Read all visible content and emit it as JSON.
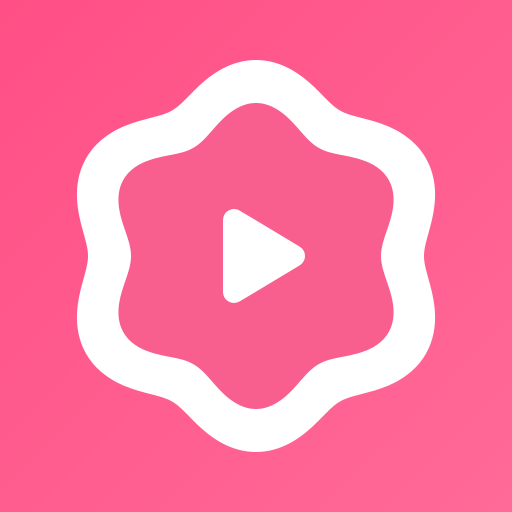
{
  "icon": {
    "name": "video-player-app-icon",
    "glyph": "play-icon",
    "badge_shape": "wavy-six-lobed-flower",
    "colors": {
      "background_start": "#ff4f86",
      "background_end": "#ff6a98",
      "badge_outline": "#ffffff",
      "badge_fill": "#f85f8f",
      "play_glyph": "#ffffff"
    }
  }
}
